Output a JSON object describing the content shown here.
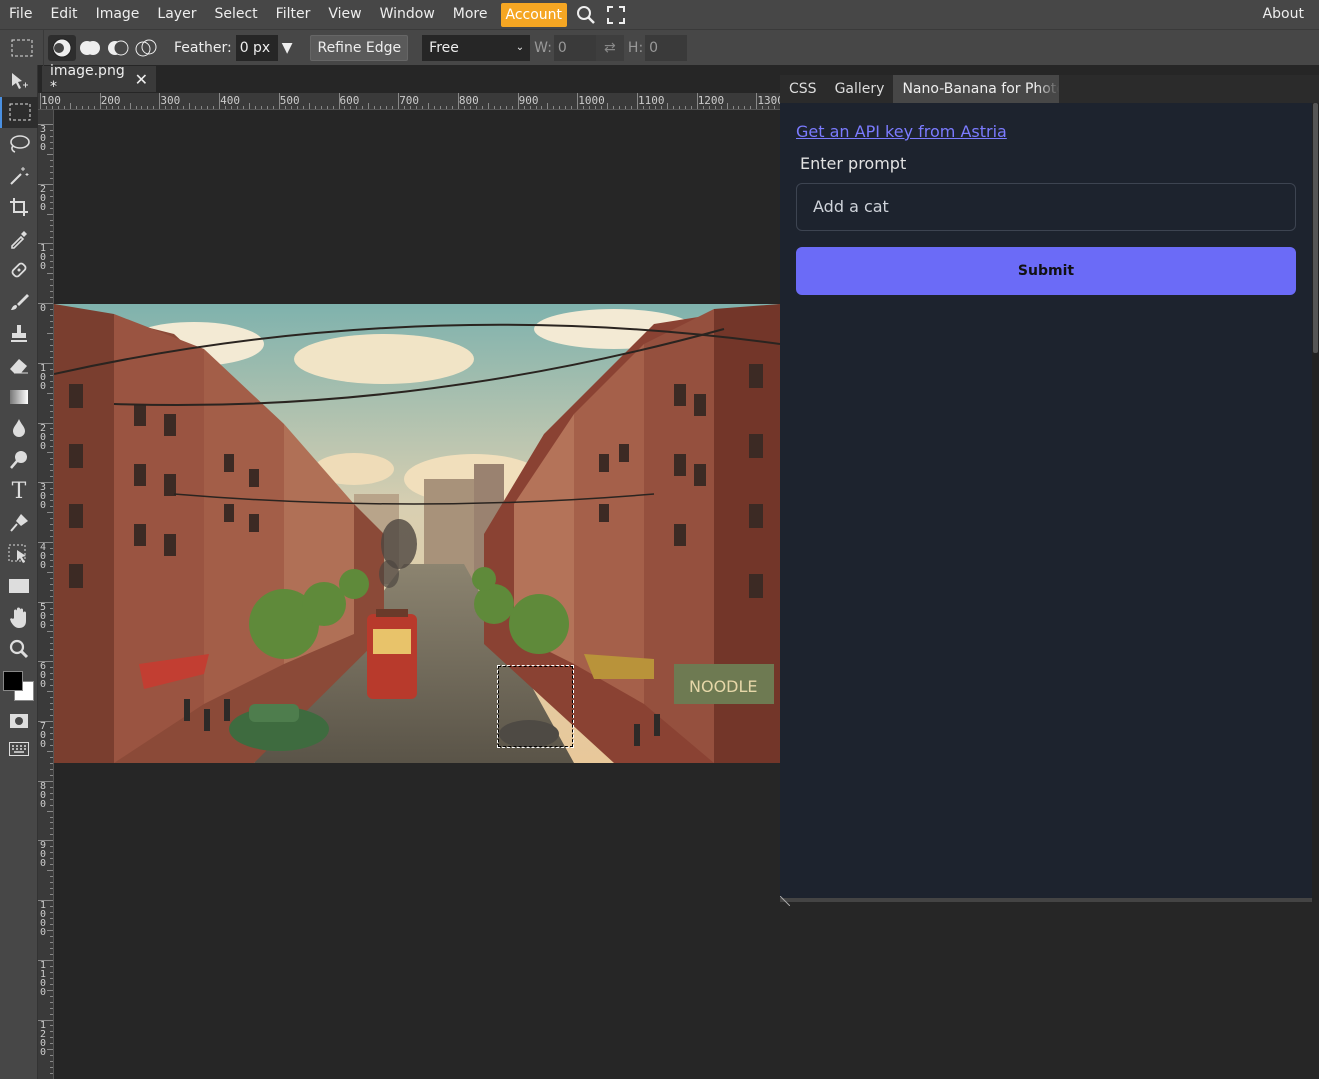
{
  "menubar": {
    "items": [
      "File",
      "Edit",
      "Image",
      "Layer",
      "Select",
      "Filter",
      "View",
      "Window",
      "More"
    ],
    "account": "Account",
    "about": "About",
    "accent_color": "#f5a623"
  },
  "options": {
    "feather_label": "Feather:",
    "feather_value": "0 px",
    "refine_edge": "Refine Edge",
    "style_value": "Free",
    "w_label": "W:",
    "w_value": "0",
    "h_label": "H:",
    "h_value": "0"
  },
  "document": {
    "tab_title": "image.png *"
  },
  "rulers": {
    "h_ticks": [
      "100",
      "200",
      "300",
      "400",
      "500",
      "600",
      "700",
      "800",
      "900",
      "1000",
      "1100",
      "1200",
      "1300"
    ],
    "v_ticks": [
      "300",
      "200",
      "100",
      "0",
      "100",
      "200",
      "300",
      "400",
      "500",
      "600",
      "700",
      "800",
      "900",
      "1000",
      "1100",
      "1200"
    ]
  },
  "panel": {
    "tabs": [
      "CSS",
      "Gallery",
      "Nano-Banana for Photop"
    ],
    "api_link": "Get an API key from Astria",
    "prompt_label": "Enter prompt",
    "prompt_value": "Add a cat",
    "submit_label": "Submit",
    "submit_color": "#6b6bf7",
    "bg_color": "#1d232e"
  },
  "tools": [
    "move-icon",
    "marquee-icon",
    "lasso-icon",
    "magic-wand-icon",
    "crop-icon",
    "eyedropper-icon",
    "healing-icon",
    "brush-icon",
    "stamp-icon",
    "eraser-icon",
    "gradient-icon",
    "blur-icon",
    "dodge-icon",
    "type-icon",
    "pen-icon",
    "path-select-icon",
    "shape-icon",
    "hand-icon",
    "zoom-icon"
  ]
}
